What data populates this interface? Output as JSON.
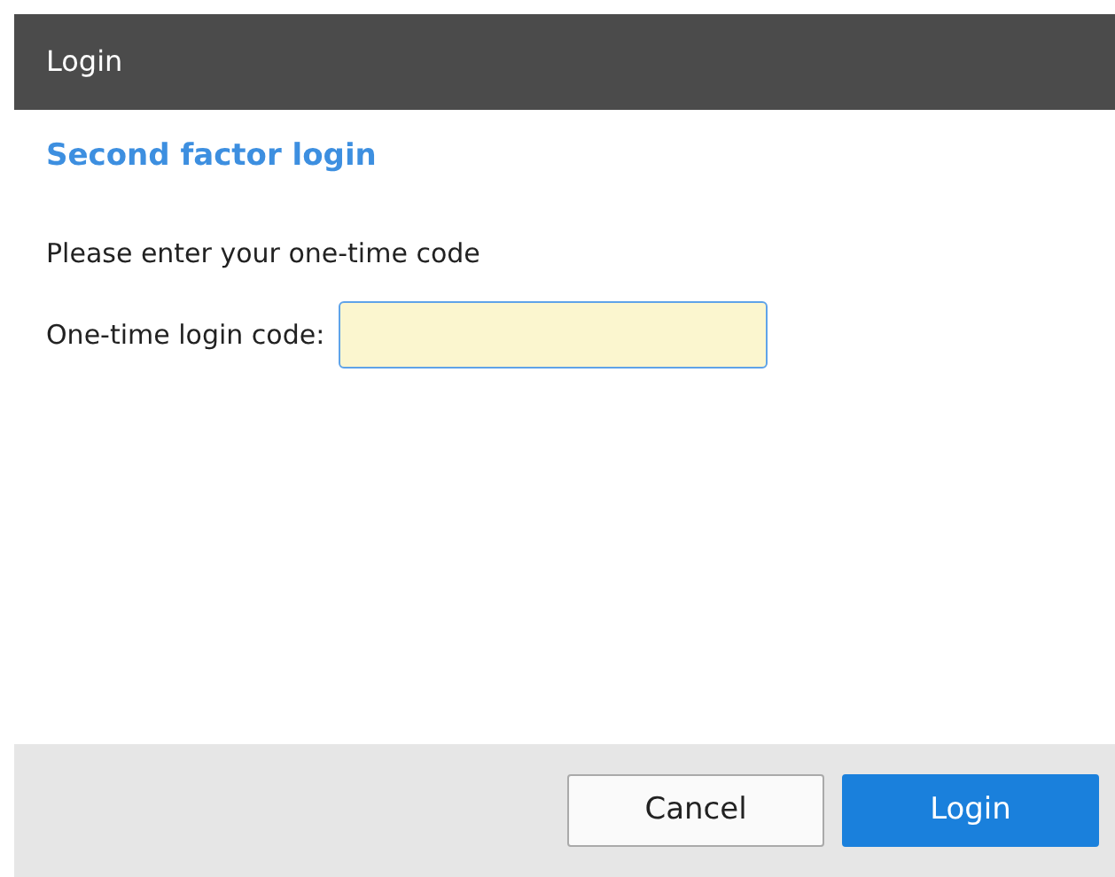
{
  "window": {
    "title": "Login"
  },
  "heading": "Second factor login",
  "instruction": "Please enter your one-time code",
  "code_field": {
    "label": "One-time login code:",
    "focused": true
  },
  "buttons": [
    {
      "label": "Cancel",
      "kind": "secondary"
    },
    {
      "label": "Login",
      "kind": "primary"
    }
  ]
}
